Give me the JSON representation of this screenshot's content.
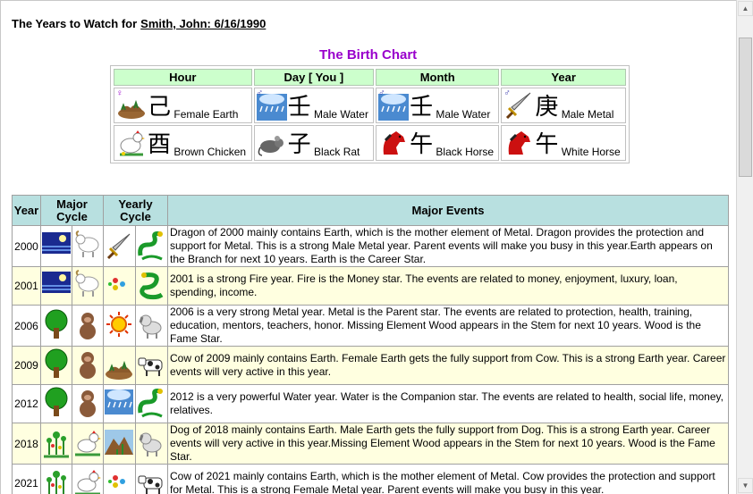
{
  "header": {
    "label": "The Years to Watch for",
    "person": "Smith, John: 6/16/1990"
  },
  "birth_chart": {
    "title": "The Birth Chart",
    "columns": [
      "Hour",
      "Day [ You ]",
      "Month",
      "Year"
    ],
    "stems": [
      {
        "char": "己",
        "label": "Female Earth",
        "icon": "earth-icon",
        "gender": "♀"
      },
      {
        "char": "壬",
        "label": "Male Water",
        "icon": "rain-water-icon",
        "gender": "♂"
      },
      {
        "char": "壬",
        "label": "Male Water",
        "icon": "rain-water-icon",
        "gender": "♂"
      },
      {
        "char": "庚",
        "label": "Male Metal",
        "icon": "sword-metal-icon",
        "gender": "♂"
      }
    ],
    "branches": [
      {
        "char": "酉",
        "label": "Brown Chicken",
        "icon": "chicken-icon"
      },
      {
        "char": "子",
        "label": "Black Rat",
        "icon": "rat-icon"
      },
      {
        "char": "午",
        "label": "Black Horse",
        "icon": "horse-icon"
      },
      {
        "char": "午",
        "label": "White Horse",
        "icon": "horse-icon"
      }
    ]
  },
  "events": {
    "headers": {
      "year": "Year",
      "major": "Major Cycle",
      "yearly": "Yearly Cycle",
      "events": "Major Events"
    },
    "rows": [
      {
        "year": "2000",
        "major": [
          "night-water-icon",
          "goat-icon"
        ],
        "yearly": [
          "sword-metal-icon",
          "dragon-icon"
        ],
        "text": "Dragon of 2000 mainly contains Earth, which is the mother element of Metal. Dragon provides the protection and support for Metal. This is a strong Male Metal year. Parent events will make you busy in this year.Earth appears on the Branch for next 10 years. Earth is the Career Star."
      },
      {
        "year": "2001",
        "major": [
          "night-water-icon",
          "goat-icon"
        ],
        "yearly": [
          "gems-metal-icon",
          "snake-icon"
        ],
        "text": "2001 is a strong Fire year. Fire is the Money star. The events are related to money, enjoyment, luxury, loan, spending, income."
      },
      {
        "year": "2006",
        "major": [
          "tree-icon",
          "monkey-icon"
        ],
        "yearly": [
          "sun-fire-icon",
          "dog-icon"
        ],
        "text": "2006 is a very strong Metal year. Metal is the Parent star. The events are related to protection, health, training, education, mentors, teachers, honor. Missing Element Wood appears in the Stem for next 10 years. Wood is the Fame Star."
      },
      {
        "year": "2009",
        "major": [
          "tree-icon",
          "monkey-icon"
        ],
        "yearly": [
          "earth-icon",
          "cow-icon"
        ],
        "text": "Cow of 2009 mainly contains Earth. Female Earth gets the fully support from Cow. This is a strong Earth year. Career events will very active in this year."
      },
      {
        "year": "2012",
        "major": [
          "tree-icon",
          "monkey-icon"
        ],
        "yearly": [
          "rain-water-icon",
          "dragon-icon"
        ],
        "text": "2012 is a very powerful Water year. Water is the Companion star. The events are related to health, social life, money, relatives."
      },
      {
        "year": "2018",
        "major": [
          "flower-wood-icon",
          "chicken-icon"
        ],
        "yearly": [
          "mountain-earth-icon",
          "dog-icon"
        ],
        "text": "Dog of 2018 mainly contains Earth. Male Earth gets the fully support from Dog. This is a strong Earth year. Career events will very active in this year.Missing Element Wood appears in the Stem for next 10 years. Wood is the Fame Star."
      },
      {
        "year": "2021",
        "major": [
          "flower-wood-icon",
          "chicken-icon"
        ],
        "yearly": [
          "gems-metal-icon",
          "cow-icon"
        ],
        "text": "Cow of 2021 mainly contains Earth, which is the mother element of Metal. Cow provides the protection and support for Metal. This is a strong Female Metal year. Parent events will make you busy in this year."
      }
    ]
  }
}
